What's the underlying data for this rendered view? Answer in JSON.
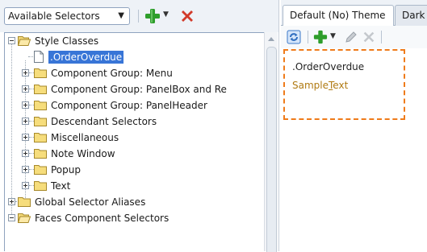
{
  "toolbar": {
    "selector_dropdown": {
      "value": "Available Selectors"
    }
  },
  "tree": {
    "items": [
      {
        "label": "Style Classes",
        "icon": "folder-open-icon",
        "expanded": true
      },
      {
        "label": ".OrderOverdue",
        "icon": "file-icon",
        "selected": true
      },
      {
        "label": "Component Group: Menu",
        "icon": "folder-icon"
      },
      {
        "label": "Component Group: PanelBox and Re",
        "icon": "folder-icon"
      },
      {
        "label": "Component Group: PanelHeader",
        "icon": "folder-icon"
      },
      {
        "label": "Descendant Selectors",
        "icon": "folder-icon"
      },
      {
        "label": "Miscellaneous",
        "icon": "folder-icon"
      },
      {
        "label": "Note Window",
        "icon": "folder-icon"
      },
      {
        "label": "Popup",
        "icon": "folder-icon"
      },
      {
        "label": "Text",
        "icon": "folder-icon"
      },
      {
        "label": "Global Selector Aliases",
        "icon": "folder-icon"
      },
      {
        "label": "Faces Component Selectors",
        "icon": "folder-open-icon",
        "expanded": true
      }
    ]
  },
  "right_panel": {
    "tabs": [
      {
        "label": "Default (No) Theme",
        "active": true
      },
      {
        "label": "Dark",
        "active": false
      }
    ],
    "preview": {
      "class_name": ".OrderOverdue",
      "sample_text": "SampleText",
      "sample_text_mnemonic": "T"
    }
  },
  "colors": {
    "selection": "#3875d7",
    "add": "#2e9e2b",
    "delete": "#d23a2a",
    "preview_border": "#ef7b1a",
    "preview_text": "#b07a12"
  }
}
